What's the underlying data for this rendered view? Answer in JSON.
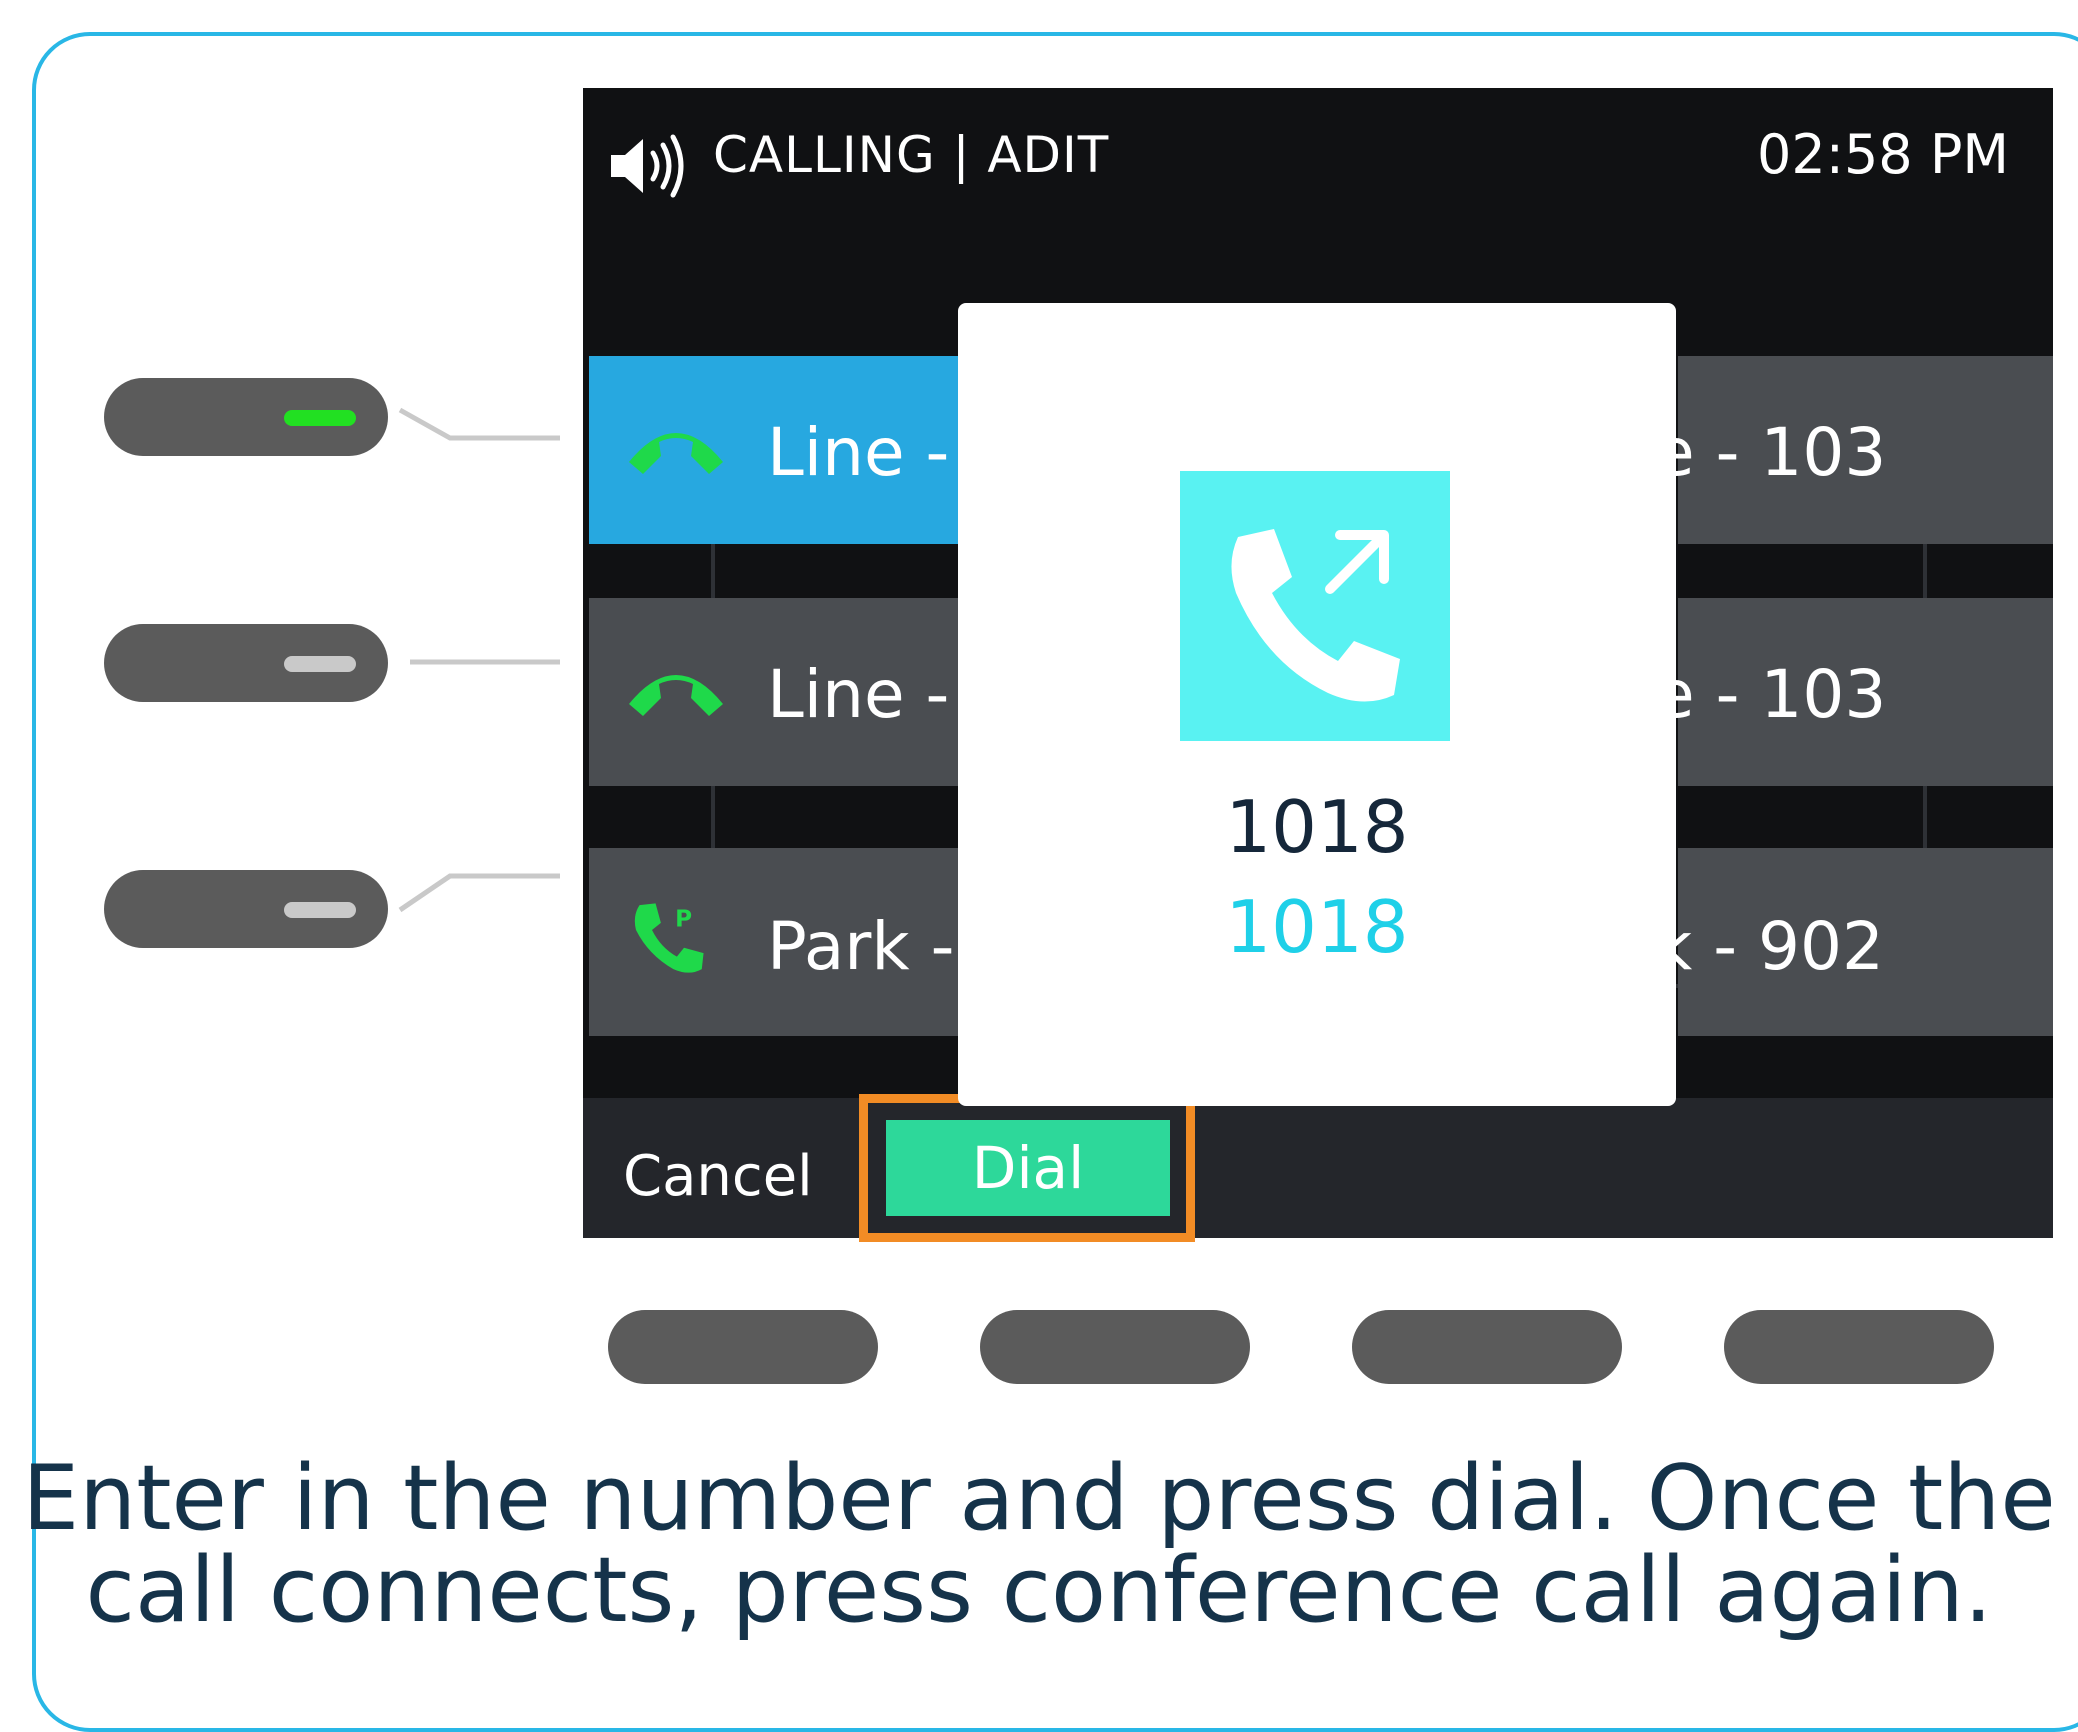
{
  "status_bar": {
    "icon": "speaker-icon",
    "title": "CALLING | ADIT",
    "time": "02:58 PM"
  },
  "lines": [
    {
      "icon": "handset-icon",
      "label_left": "Line -",
      "label_right": "e - 103",
      "selected": true,
      "led": "on"
    },
    {
      "icon": "handset-icon",
      "label_left": "Line -",
      "label_right": "e - 103",
      "selected": false,
      "led": "off"
    },
    {
      "icon": "park-icon",
      "label_left": "Park -",
      "label_right": "k - 902",
      "selected": false,
      "led": "off"
    }
  ],
  "dialog": {
    "icon": "outgoing-call-icon",
    "number": "1018",
    "number_entry": "1018"
  },
  "softkeys": {
    "cancel_label": "Cancel",
    "dial_label": "Dial"
  },
  "caption": {
    "line1": "Enter in the number and press dial. Once the",
    "line2": "call connects, press conference call again."
  },
  "colors": {
    "frame": "#29b7e6",
    "selected_row": "#27a8e0",
    "dial_button": "#2dd89a",
    "highlight": "#f28c25",
    "led_active": "#22e022",
    "dialog_icon_bg": "#59f2f2",
    "number_entry": "#1fd0e8"
  }
}
